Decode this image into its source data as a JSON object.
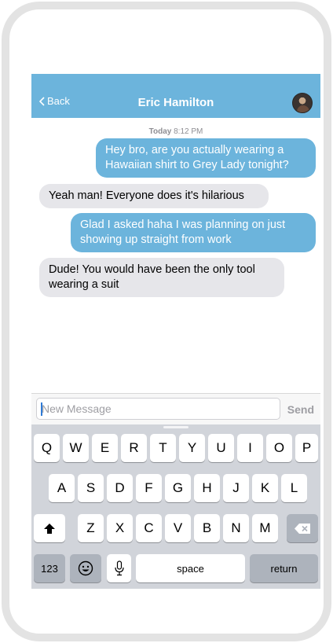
{
  "nav": {
    "back_label": "Back",
    "title": "Eric Hamilton"
  },
  "chat": {
    "timestamp_day": "Today",
    "timestamp_time": "8:12 PM",
    "messages": [
      {
        "side": "out",
        "line1": "Hey bro, are you actually wearing a",
        "line2": "Hawaiian shirt to Grey Lady tonight?"
      },
      {
        "side": "in",
        "line1": "Yeah man! Everyone does it's hilarious",
        "line2": ""
      },
      {
        "side": "out",
        "line1": "Glad I asked haha I was planning on just",
        "line2": "showing up straight from work"
      },
      {
        "side": "in",
        "line1": "Dude! You would have been the only tool",
        "line2": "wearing a suit"
      }
    ]
  },
  "input": {
    "placeholder": "New Message",
    "value": "",
    "send_label": "Send"
  },
  "keyboard": {
    "row1": [
      "Q",
      "W",
      "E",
      "R",
      "T",
      "Y",
      "U",
      "I",
      "O",
      "P"
    ],
    "row2": [
      "A",
      "S",
      "D",
      "F",
      "G",
      "H",
      "J",
      "K",
      "L"
    ],
    "row3": [
      "Z",
      "X",
      "C",
      "V",
      "B",
      "N",
      "M"
    ],
    "numbers_label": "123",
    "space_label": "space",
    "return_label": "return"
  },
  "colors": {
    "accent": "#6cb4dc",
    "incoming_bubble": "#e6e6ea",
    "keyboard_bg": "#d1d4da"
  },
  "icons": {
    "back": "chevron-left-icon",
    "shift": "shift-arrow-icon",
    "delete": "backspace-icon",
    "emoji": "emoji-face-icon",
    "dictation": "microphone-icon"
  }
}
